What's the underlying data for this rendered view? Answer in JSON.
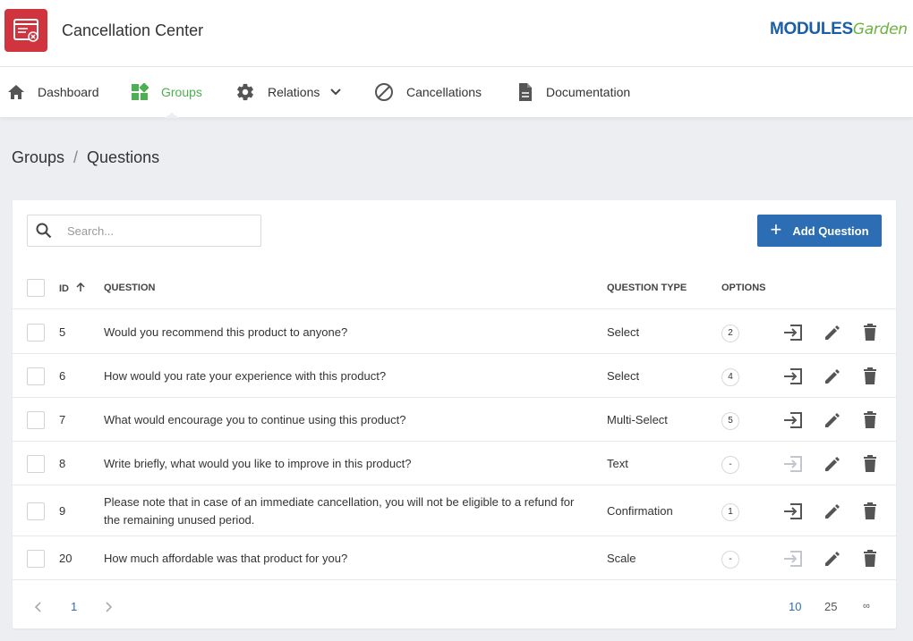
{
  "app": {
    "title": "Cancellation Center",
    "logo_left": "MODULES",
    "logo_right": "Garden"
  },
  "nav": [
    {
      "label": "Dashboard",
      "icon": "home-icon"
    },
    {
      "label": "Groups",
      "icon": "groups-icon",
      "active": true
    },
    {
      "label": "Relations",
      "icon": "gear-icon"
    },
    {
      "label": "Cancellations",
      "icon": "block-icon"
    },
    {
      "label": "Documentation",
      "icon": "document-icon"
    }
  ],
  "breadcrumb": {
    "parent": "Groups",
    "separator": "/",
    "current": "Questions"
  },
  "toolbar": {
    "search_placeholder": "Search...",
    "add_label": "Add Question"
  },
  "table": {
    "headers": {
      "id": "ID",
      "question": "QUESTION",
      "type": "QUESTION TYPE",
      "options": "OPTIONS"
    },
    "rows": [
      {
        "id": "5",
        "question": "Would you recommend this product to anyone?",
        "type": "Select",
        "options": "2",
        "move_enabled": true
      },
      {
        "id": "6",
        "question": "How would you rate your experience with this product?",
        "type": "Select",
        "options": "4",
        "move_enabled": true
      },
      {
        "id": "7",
        "question": "What would encourage you to continue using this product?",
        "type": "Multi-Select",
        "options": "5",
        "move_enabled": true
      },
      {
        "id": "8",
        "question": "Write briefly, what would you like to improve in this product?",
        "type": "Text",
        "options": "-",
        "move_enabled": false
      },
      {
        "id": "9",
        "question": "Please note that in case of an immediate cancellation, you will not be eligible to a refund for the remaining unused period.",
        "type": "Confirmation",
        "options": "1",
        "move_enabled": true
      },
      {
        "id": "20",
        "question": "How much affordable was that product for you?",
        "type": "Scale",
        "options": "-",
        "move_enabled": false
      }
    ]
  },
  "pagination": {
    "current_page": "1",
    "page_sizes": [
      "10",
      "25",
      "∞"
    ],
    "selected_size": "10"
  },
  "colors": {
    "accent": "#2c6db4",
    "active_nav": "#4caf50",
    "app_icon": "#d0353f"
  }
}
